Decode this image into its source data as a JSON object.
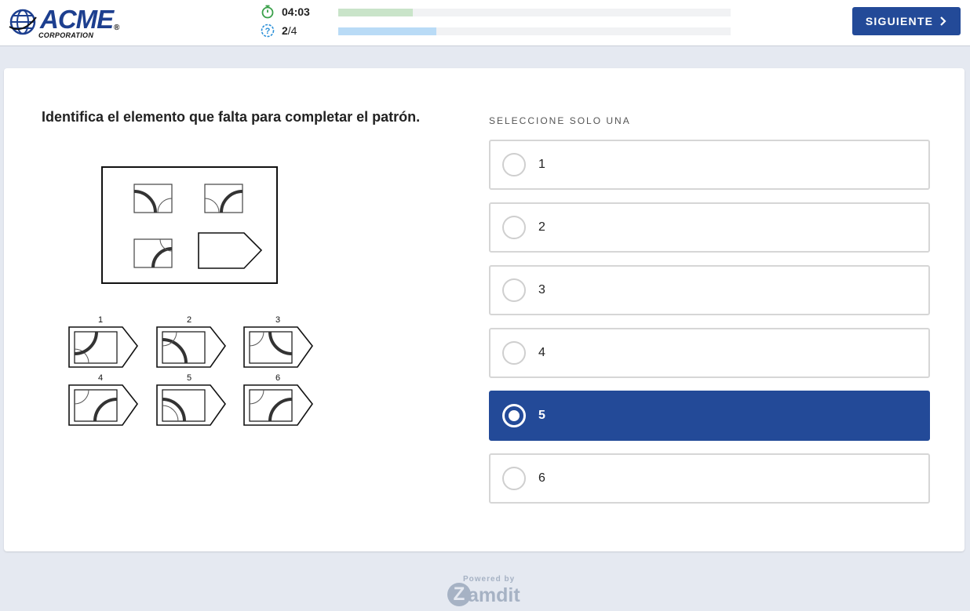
{
  "header": {
    "logo": {
      "brand": "ACME",
      "subtitle": "CORPORATION",
      "registered": "®"
    },
    "timer": {
      "icon": "stopwatch-icon",
      "value": "04:03",
      "progress": 0.19,
      "color": "#c9e4c9"
    },
    "question_counter": {
      "icon": "question-circle-icon",
      "current": "2",
      "total": "/4",
      "progress": 0.25,
      "color": "#b9dbf6"
    },
    "next_button": {
      "label": "SIGUIENTE",
      "icon": "chevron-right-icon"
    }
  },
  "main": {
    "question": "Identifica el elemento que falta para completar el patrón.",
    "figure": {
      "option_numbers": [
        "1",
        "2",
        "3",
        "4",
        "5",
        "6"
      ]
    },
    "instruction": "SELECCIONE SOLO UNA",
    "options": [
      {
        "label": "1",
        "selected": false
      },
      {
        "label": "2",
        "selected": false
      },
      {
        "label": "3",
        "selected": false
      },
      {
        "label": "4",
        "selected": false
      },
      {
        "label": "5",
        "selected": true
      },
      {
        "label": "6",
        "selected": false
      }
    ]
  },
  "footer": {
    "powered_by": "Powered by",
    "brand_initial": "Z",
    "brand_rest": "amdit"
  },
  "colors": {
    "accent": "#234a98",
    "background": "#e5e9f1"
  }
}
